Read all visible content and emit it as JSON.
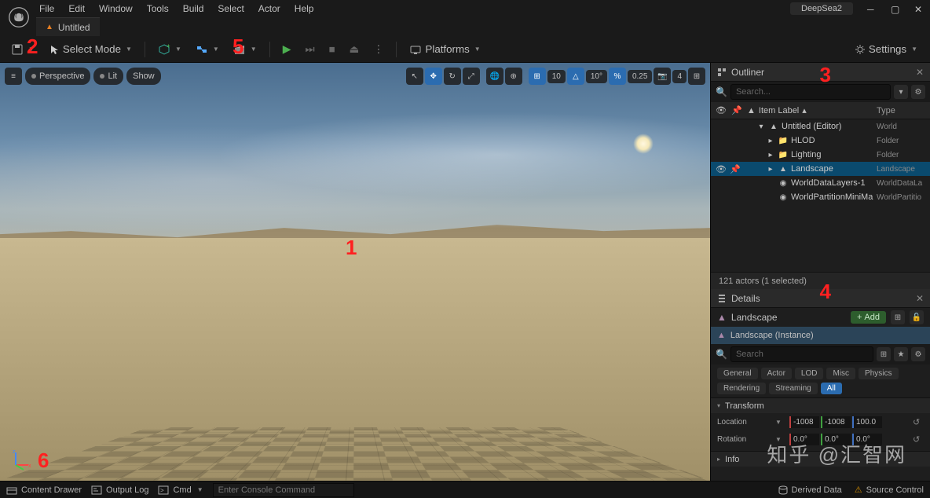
{
  "project": "DeepSea2",
  "menu": [
    "File",
    "Edit",
    "Window",
    "Tools",
    "Build",
    "Select",
    "Actor",
    "Help"
  ],
  "tab": {
    "title": "Untitled"
  },
  "toolbar": {
    "save": "",
    "mode": "Select Mode",
    "platforms": "Platforms",
    "settings": "Settings"
  },
  "viewport": {
    "hamburger": "≡",
    "perspective": "Perspective",
    "lit": "Lit",
    "show": "Show",
    "snap_grid": "10",
    "snap_angle": "10°",
    "snap_scale": "0.25",
    "cam_speed": "4"
  },
  "outliner": {
    "title": "Outliner",
    "search_ph": "Search...",
    "col_label": "Item Label",
    "col_type": "Type",
    "rows": [
      {
        "indent": 1,
        "exp": "▾",
        "icon": "▲",
        "name": "Untitled (Editor)",
        "type": "World"
      },
      {
        "indent": 2,
        "exp": "▸",
        "icon": "📁",
        "name": "HLOD",
        "type": "Folder"
      },
      {
        "indent": 2,
        "exp": "▸",
        "icon": "📁",
        "name": "Lighting",
        "type": "Folder"
      },
      {
        "indent": 2,
        "exp": "▸",
        "icon": "▲",
        "name": "Landscape",
        "type": "Landscape",
        "selected": true
      },
      {
        "indent": 2,
        "exp": "",
        "icon": "◉",
        "name": "WorldDataLayers-1",
        "type": "WorldDataLa"
      },
      {
        "indent": 2,
        "exp": "",
        "icon": "◉",
        "name": "WorldPartitionMiniMap",
        "type": "WorldPartitio"
      }
    ],
    "status": "121 actors (1 selected)"
  },
  "details": {
    "title": "Details",
    "actor": "Landscape",
    "add": "Add",
    "component": "Landscape (Instance)",
    "search_ph": "Search",
    "filters": [
      "General",
      "Actor",
      "LOD",
      "Misc",
      "Physics",
      "Rendering",
      "Streaming",
      "All"
    ],
    "filter_active": "All",
    "transform_label": "Transform",
    "location_label": "Location",
    "rotation_label": "Rotation",
    "info_label": "Info",
    "location": {
      "x": "-1008",
      "y": "-1008",
      "z": "100.0"
    },
    "rotation": {
      "x": "0.0°",
      "y": "0.0°",
      "z": "0.0°"
    }
  },
  "statusbar": {
    "content_drawer": "Content Drawer",
    "output_log": "Output Log",
    "cmd": "Cmd",
    "cmd_ph": "Enter Console Command",
    "derived": "Derived Data",
    "source": "Source Control"
  },
  "annotations": {
    "a1": "1",
    "a2": "2",
    "a3": "3",
    "a4": "4",
    "a5": "5",
    "a6": "6"
  },
  "watermark": "知乎 @汇智网"
}
